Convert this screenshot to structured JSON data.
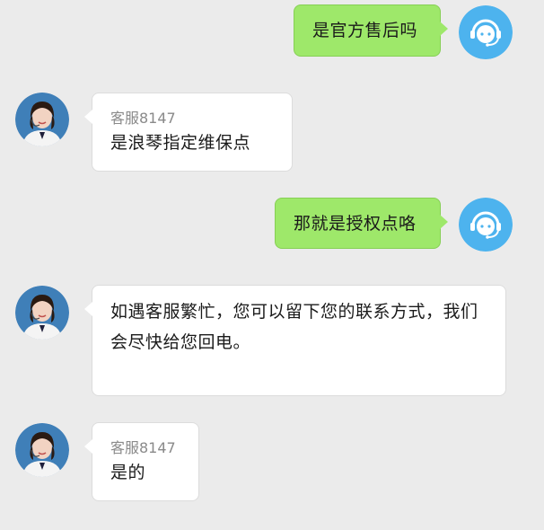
{
  "messages": [
    {
      "sender": "user",
      "text": "是官方售后吗"
    },
    {
      "sender": "agent",
      "name": "客服8147",
      "text": "是浪琴指定维保点"
    },
    {
      "sender": "user",
      "text": "那就是授权点咯"
    },
    {
      "sender": "agent",
      "text": "如遇客服繁忙，您可以留下您的联系方式，我们会尽快给您回电。"
    },
    {
      "sender": "agent",
      "name": "客服8147",
      "text": "是的"
    }
  ],
  "colors": {
    "background": "#ebebeb",
    "user_bubble": "#9ee86a",
    "agent_bubble": "#ffffff",
    "user_avatar": "#4db3ee"
  },
  "icons": {
    "user_avatar": "customer-service-headset-icon",
    "agent_avatar": "agent-photo"
  }
}
